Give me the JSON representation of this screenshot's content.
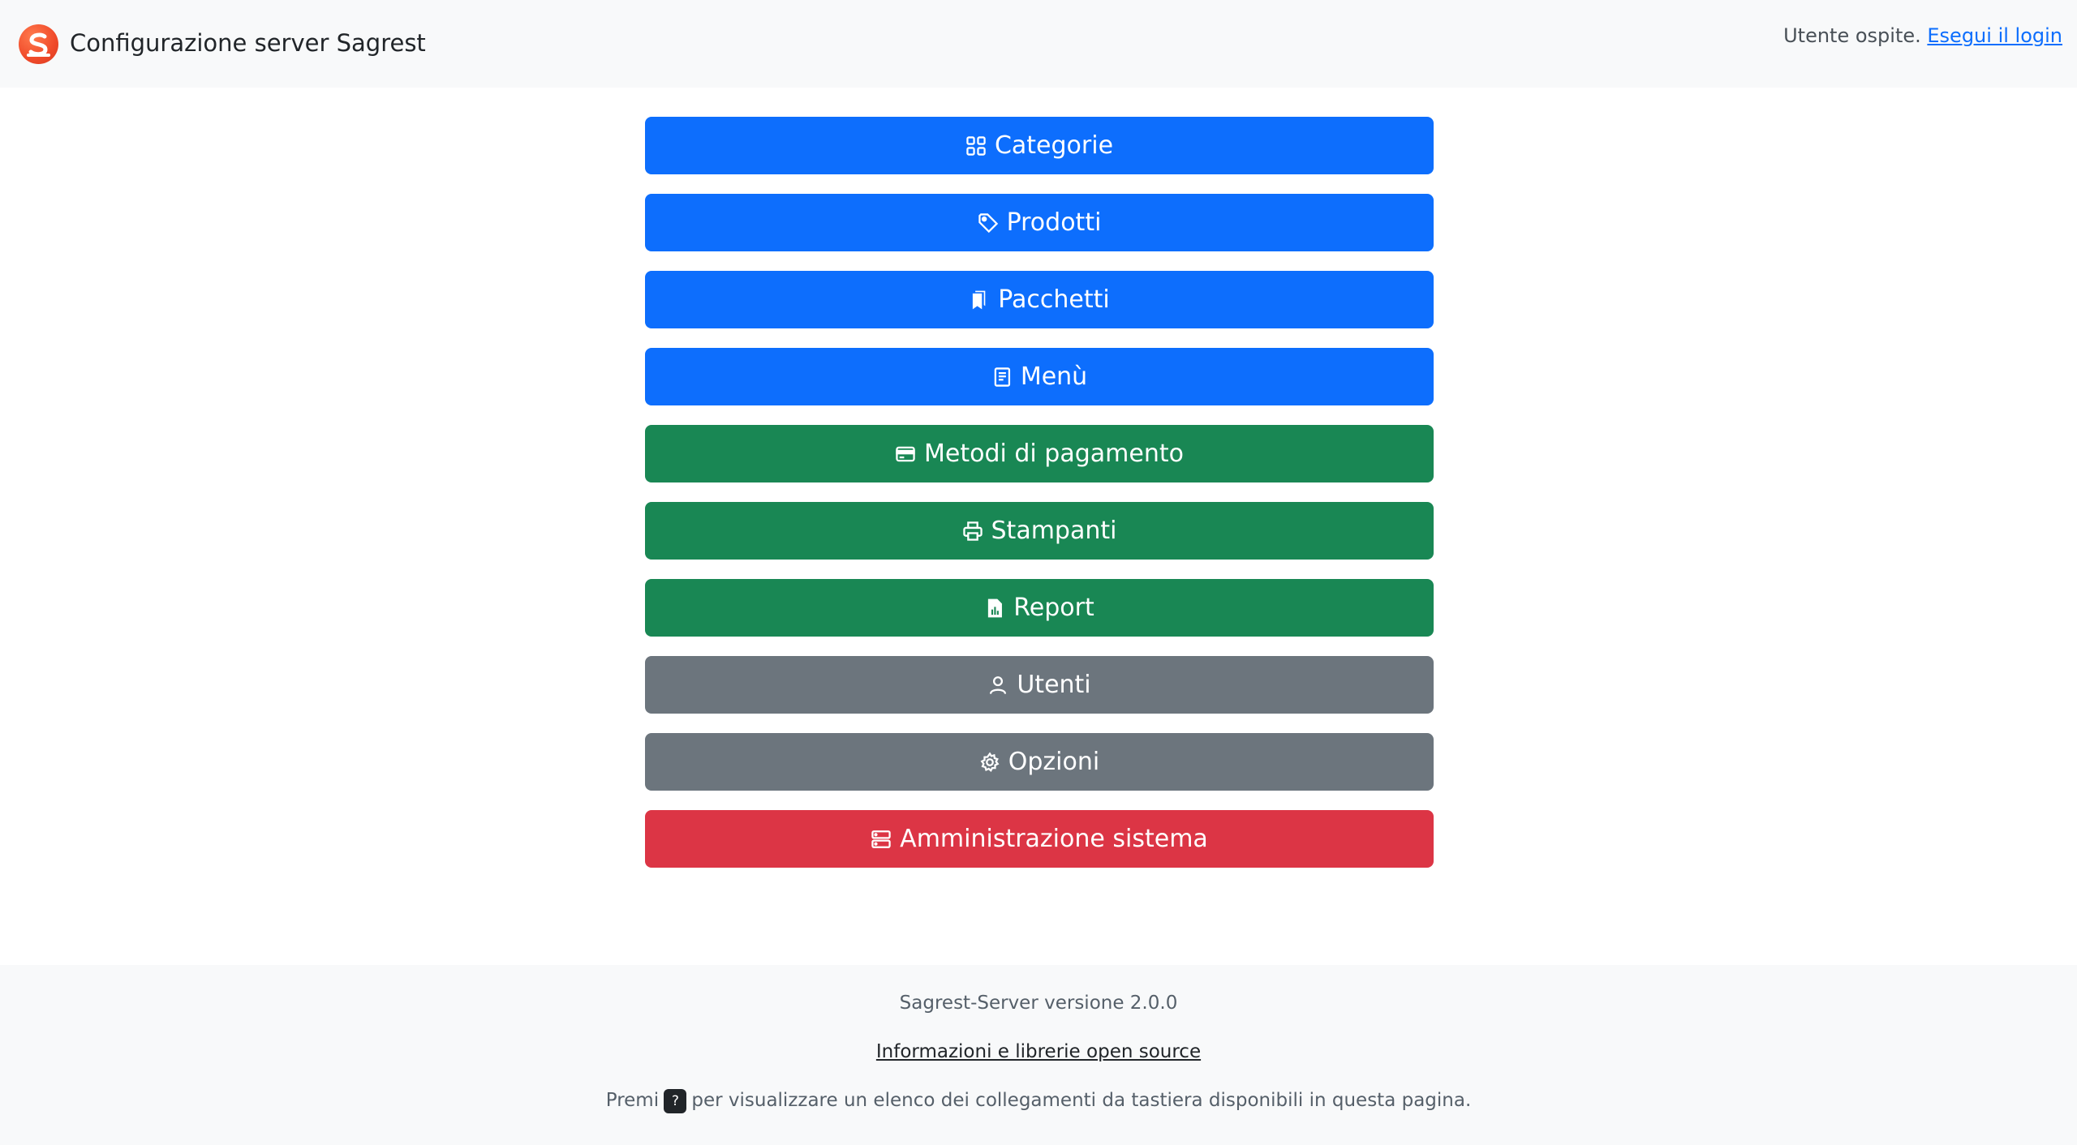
{
  "header": {
    "title": "Configurazione server Sagrest",
    "guest_text": "Utente ospite.",
    "login_link": "Esegui il login"
  },
  "menu": {
    "categorie": {
      "label": "Categorie",
      "icon": "grid-icon",
      "color": "#0d6efd"
    },
    "prodotti": {
      "label": "Prodotti",
      "icon": "tag-icon",
      "color": "#0d6efd"
    },
    "pacchetti": {
      "label": "Pacchetti",
      "icon": "bookmarks-icon",
      "color": "#0d6efd"
    },
    "menu": {
      "label": "Menù",
      "icon": "journal-icon",
      "color": "#0d6efd"
    },
    "metodi_pagamento": {
      "label": "Metodi di pagamento",
      "icon": "credit-card-icon",
      "color": "#198754"
    },
    "stampanti": {
      "label": "Stampanti",
      "icon": "printer-icon",
      "color": "#198754"
    },
    "report": {
      "label": "Report",
      "icon": "file-chart-icon",
      "color": "#198754"
    },
    "utenti": {
      "label": "Utenti",
      "icon": "person-icon",
      "color": "#6c757d"
    },
    "opzioni": {
      "label": "Opzioni",
      "icon": "gear-icon",
      "color": "#6c757d"
    },
    "amministrazione": {
      "label": "Amministrazione sistema",
      "icon": "server-icon",
      "color": "#dc3545"
    }
  },
  "footer": {
    "version": "Sagrest-Server versione 2.0.0",
    "oss_link": "Informazioni e librerie open source",
    "shortcut_prefix": "Premi",
    "shortcut_key": "?",
    "shortcut_suffix": "per visualizzare un elenco dei collegamenti da tastiera disponibili in questa pagina."
  }
}
